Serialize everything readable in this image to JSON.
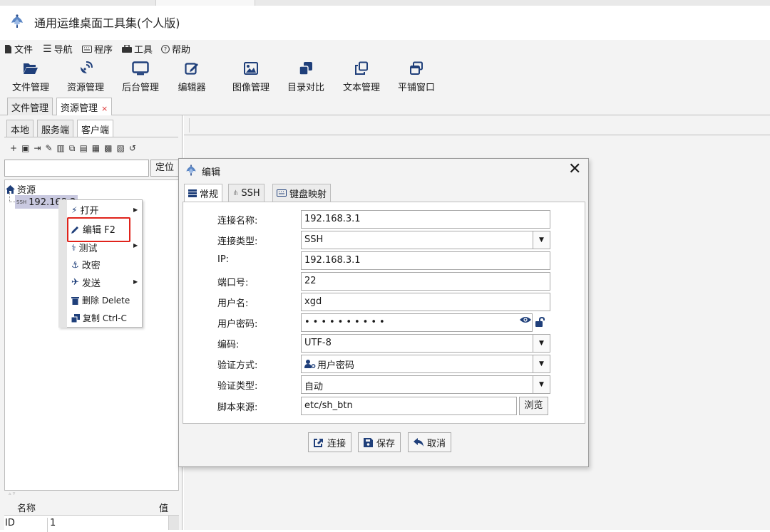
{
  "app": {
    "title": "通用运维桌面工具集(个人版)"
  },
  "menubar": {
    "file": "文件",
    "nav": "导航",
    "program": "程序",
    "tools": "工具",
    "help": "帮助"
  },
  "toolbar": [
    {
      "label": "文件管理",
      "icon": "folder-open-icon"
    },
    {
      "label": "资源管理",
      "icon": "satellite-dish-icon"
    },
    {
      "label": "后台管理",
      "icon": "monitor-icon"
    },
    {
      "label": "编辑器",
      "icon": "edit-icon"
    },
    {
      "label": "图像管理",
      "icon": "image-icon"
    },
    {
      "label": "目录对比",
      "icon": "clone-icon"
    },
    {
      "label": "文本管理",
      "icon": "copy-icon"
    },
    {
      "label": "平铺窗口",
      "icon": "windows-icon"
    }
  ],
  "main_tabs": [
    {
      "label": "文件管理"
    },
    {
      "label": "资源管理",
      "close": "×"
    }
  ],
  "side_tabs": [
    {
      "label": "本地"
    },
    {
      "label": "服务端"
    },
    {
      "label": "客户端"
    }
  ],
  "mini_toolbar": {
    "glyphs": [
      "+",
      "▣",
      "⇥",
      "✎",
      "▥",
      "⧉",
      "▤",
      "▦",
      "▩",
      "▧",
      "↺"
    ]
  },
  "search": {
    "value": "",
    "button": "定位"
  },
  "tree": {
    "root": "资源",
    "node": "192.168.3.1",
    "node_tag": "SSH"
  },
  "context_menu": {
    "items": [
      {
        "label": "打开",
        "submenu": true
      },
      {
        "label": "编辑 F2"
      },
      {
        "label": "测试",
        "submenu": true
      },
      {
        "label": "改密"
      },
      {
        "label": "发送",
        "submenu": true
      },
      {
        "label": "删除 Delete"
      },
      {
        "label": "复制 Ctrl-C"
      }
    ]
  },
  "props": {
    "col_name": "名称",
    "col_value": "值",
    "row_name": "ID",
    "row_value": "1"
  },
  "dialog": {
    "title": "编辑",
    "tabs": [
      {
        "label": "常规"
      },
      {
        "label": "SSH"
      },
      {
        "label": "键盘映射"
      }
    ],
    "fields": {
      "name": {
        "label": "连接名称:",
        "value": "192.168.3.1"
      },
      "type": {
        "label": "连接类型:",
        "value": "SSH"
      },
      "ip": {
        "label": "IP:",
        "value": "192.168.3.1"
      },
      "port": {
        "label": "端口号:",
        "value": "22"
      },
      "user": {
        "label": "用户名:",
        "value": "xgd"
      },
      "password": {
        "label": "用户密码:",
        "value": "••••••••••"
      },
      "encoding": {
        "label": "编码:",
        "value": "UTF-8"
      },
      "auth": {
        "label": "验证方式:",
        "value": "用户密码"
      },
      "verify_type": {
        "label": "验证类型:",
        "value": "自动"
      },
      "script": {
        "label": "脚本来源:",
        "value": "etc/sh_btn"
      }
    },
    "browse": "浏览",
    "buttons": {
      "connect": "连接",
      "save": "保存",
      "cancel": "取消"
    }
  },
  "colors": {
    "accent": "#1f3f7a",
    "highlight": "#e0231b",
    "selection": "#c9c9e0"
  }
}
